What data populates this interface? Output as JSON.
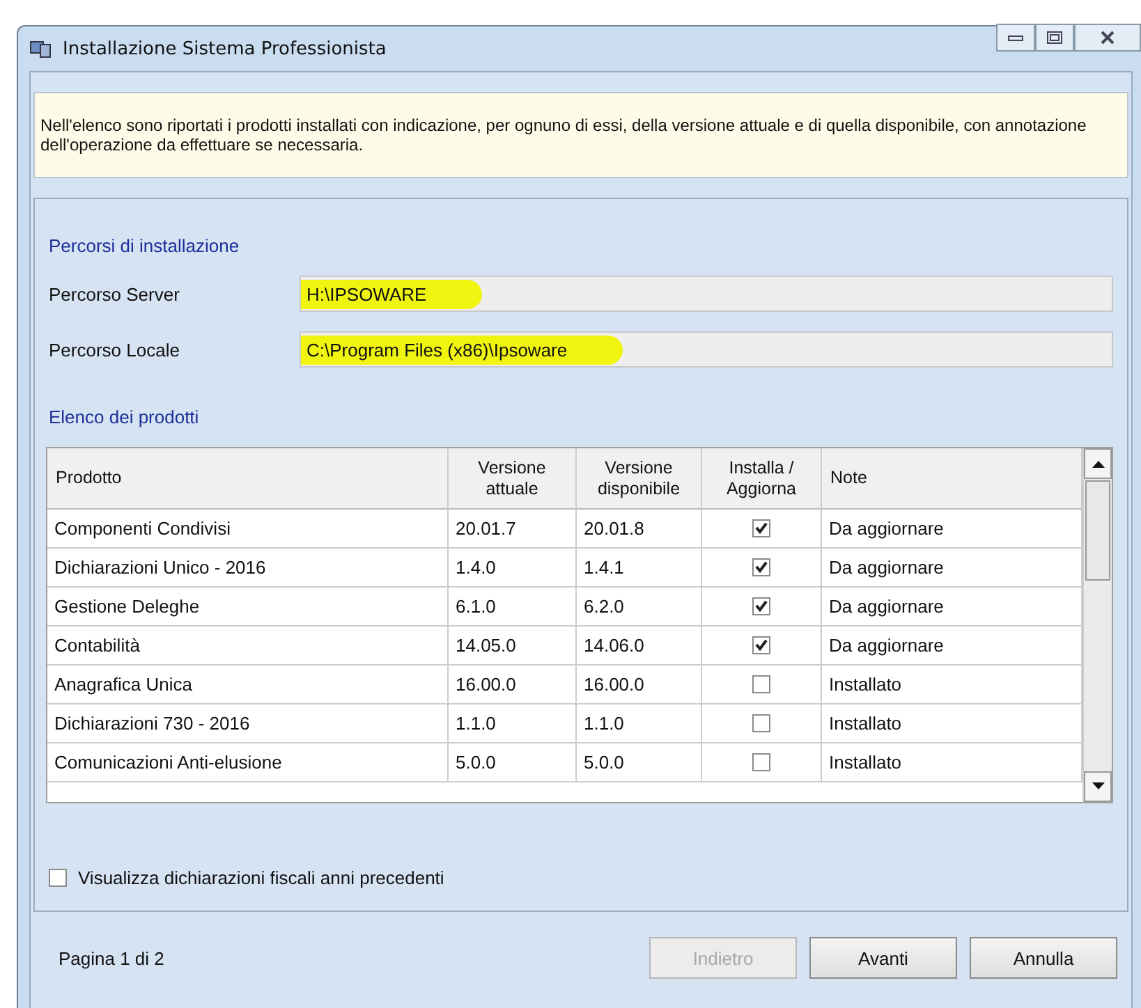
{
  "window": {
    "title": "Installazione Sistema Professionista"
  },
  "info": "Nell'elenco sono riportati i prodotti installati con indicazione, per ognuno di essi, della versione attuale e di quella disponibile, con annotazione dell'operazione da effettuare se necessaria.",
  "paths": {
    "title": "Percorsi di installazione",
    "fields": [
      {
        "label": "Percorso Server",
        "value": "H:\\IPSOWARE",
        "highlighted": true
      },
      {
        "label": "Percorso Locale",
        "value": "C:\\Program Files (x86)\\Ipsoware",
        "highlighted": true
      }
    ]
  },
  "products": {
    "title": "Elenco dei prodotti",
    "columns": [
      "Prodotto",
      "Versione attuale",
      "Versione disponibile",
      "Installa / Aggiorna",
      "Note"
    ],
    "rows": [
      {
        "product": "Componenti Condivisi",
        "current": "20.01.7",
        "available": "20.01.8",
        "checked": true,
        "note": "Da aggiornare"
      },
      {
        "product": "Dichiarazioni Unico - 2016",
        "current": "1.4.0",
        "available": "1.4.1",
        "checked": true,
        "note": "Da aggiornare"
      },
      {
        "product": "Gestione Deleghe",
        "current": "6.1.0",
        "available": "6.2.0",
        "checked": true,
        "note": "Da aggiornare"
      },
      {
        "product": "Contabilità",
        "current": "14.05.0",
        "available": "14.06.0",
        "checked": true,
        "note": "Da aggiornare"
      },
      {
        "product": "Anagrafica Unica",
        "current": "16.00.0",
        "available": "16.00.0",
        "checked": false,
        "note": "Installato"
      },
      {
        "product": "Dichiarazioni 730 - 2016",
        "current": "1.1.0",
        "available": "1.1.0",
        "checked": false,
        "note": "Installato"
      },
      {
        "product": "Comunicazioni Anti-elusione",
        "current": "5.0.0",
        "available": "5.0.0",
        "checked": false,
        "note": "Installato"
      }
    ]
  },
  "show_previous": {
    "label": "Visualizza dichiarazioni fiscali anni precedenti",
    "checked": false
  },
  "footer": {
    "page": "Pagina 1 di 2",
    "buttons": [
      {
        "label": "Indietro",
        "disabled": true
      },
      {
        "label": "Avanti",
        "disabled": false
      },
      {
        "label": "Annulla",
        "disabled": false
      }
    ]
  }
}
